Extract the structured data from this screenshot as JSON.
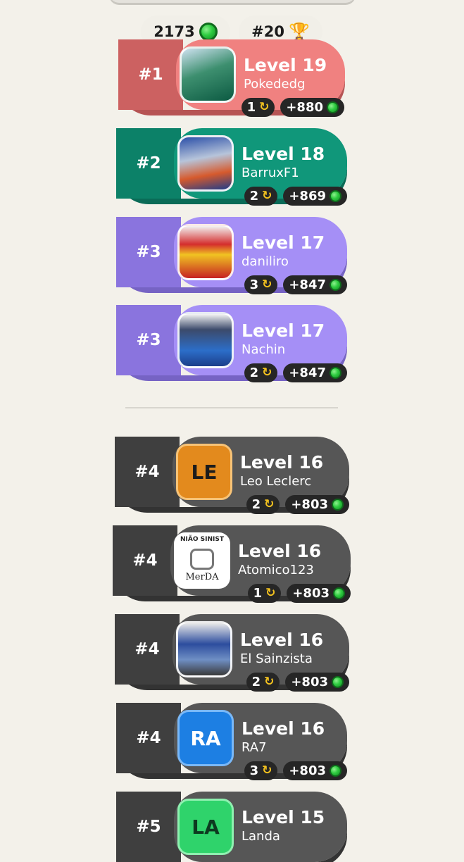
{
  "stats": {
    "gems": "2173",
    "rank": "#20"
  },
  "entries": [
    {
      "rank": "#1",
      "level": "Level 19",
      "user": "Pokededg",
      "streak": "1",
      "points": "+880",
      "color": "red"
    },
    {
      "rank": "#2",
      "level": "Level 18",
      "user": "BarruxF1",
      "streak": "2",
      "points": "+869",
      "color": "green"
    },
    {
      "rank": "#3",
      "level": "Level 17",
      "user": "daniliro",
      "streak": "3",
      "points": "+847",
      "color": "purple"
    },
    {
      "rank": "#3",
      "level": "Level 17",
      "user": "Nachin",
      "streak": "2",
      "points": "+847",
      "color": "purple"
    },
    {
      "rank": "#4",
      "level": "Level 16",
      "user": "Leo Leclerc",
      "initials": "LE",
      "streak": "2",
      "points": "+803",
      "color": "gray"
    },
    {
      "rank": "#4",
      "level": "Level 16",
      "user": "Atomico123",
      "streak": "1",
      "points": "+803",
      "color": "gray",
      "avatar_text": {
        "top": "NIÃO SINIST",
        "bottom": "MerDA"
      }
    },
    {
      "rank": "#4",
      "level": "Level 16",
      "user": "El Sainzista",
      "streak": "2",
      "points": "+803",
      "color": "gray"
    },
    {
      "rank": "#4",
      "level": "Level 16",
      "user": "RA7",
      "initials": "RA",
      "streak": "3",
      "points": "+803",
      "color": "gray"
    },
    {
      "rank": "#5",
      "level": "Level 15",
      "user": "Landa",
      "initials": "LA",
      "color": "gray"
    }
  ],
  "colors": {
    "red": "#f08180",
    "green": "#10977a",
    "purple": "#a58ff6",
    "gray": "#565656"
  }
}
